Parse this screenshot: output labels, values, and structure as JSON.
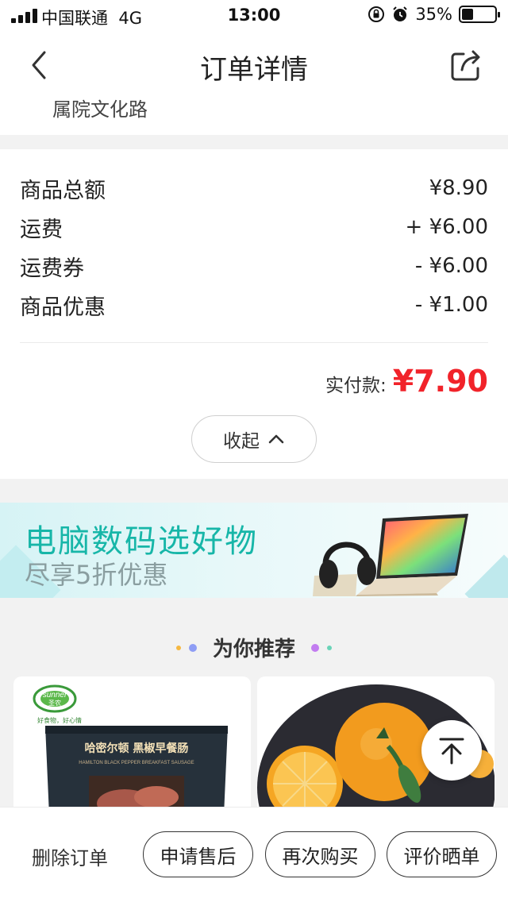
{
  "status_bar": {
    "carrier": "中国联通",
    "network": "4G",
    "time": "13:00",
    "battery": "35%"
  },
  "nav": {
    "title": "订单详情"
  },
  "address": {
    "partial": "属院文化路"
  },
  "price_summary": {
    "rows": [
      {
        "label": "商品总额",
        "value": "¥8.90"
      },
      {
        "label": "运费",
        "value": "+ ¥6.00"
      },
      {
        "label": "运费券",
        "value": "- ¥6.00"
      },
      {
        "label": "商品优惠",
        "value": "- ¥1.00"
      }
    ],
    "paid_label": "实付款:",
    "paid_value": "¥7.90",
    "paid_color": "#f1232a",
    "collapse_label": "收起"
  },
  "banner": {
    "title": "电脑数码选好物",
    "subtitle": "尽享5折优惠",
    "title_color": "#17b6a8"
  },
  "recommend": {
    "title": "为你推荐",
    "products": [
      {
        "brand": "sunner",
        "brand_cn": "圣农",
        "tagline": "好食物，好心情",
        "name": "哈密尔顿 黑椒早餐肠",
        "name_en": "HAMILTON BLACK PEPPER BREAKFAST SAUSAGE"
      },
      {
        "name": "orange"
      }
    ]
  },
  "bottom_bar": {
    "delete": "删除订单",
    "after_sale": "申请售后",
    "rebuy": "再次购买",
    "review": "评价晒单"
  }
}
